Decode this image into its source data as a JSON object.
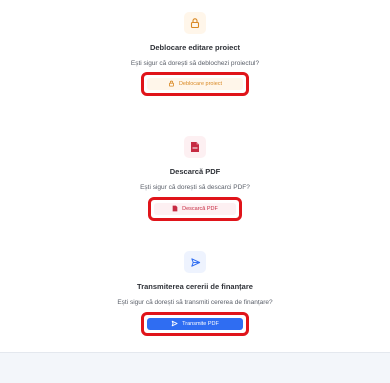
{
  "sections": [
    {
      "icon": "lock-icon",
      "title": "Deblocare editare proiect",
      "description": "Ești sigur că dorești să deblochezi proiectul?",
      "button_label": "Deblocare proiect",
      "button_icon": "lock-icon",
      "accent": "#d98924"
    },
    {
      "icon": "pdf-icon",
      "title": "Descarcă PDF",
      "description": "Ești sigur că dorești să descarci PDF?",
      "button_label": "Descarcă PDF",
      "button_icon": "pdf-icon",
      "accent": "#c62b42"
    },
    {
      "icon": "send-icon",
      "title": "Transmiterea cererii de finanțare",
      "description": "Ești sigur că dorești să transmiti cererea de finanțare?",
      "button_label": "Transmite PDF",
      "button_icon": "send-icon",
      "accent": "#2f6df2"
    }
  ],
  "colors": {
    "highlight": "#e0141a",
    "unlock": "#d98924",
    "pdf": "#c62b42",
    "primary": "#2f6df2"
  }
}
